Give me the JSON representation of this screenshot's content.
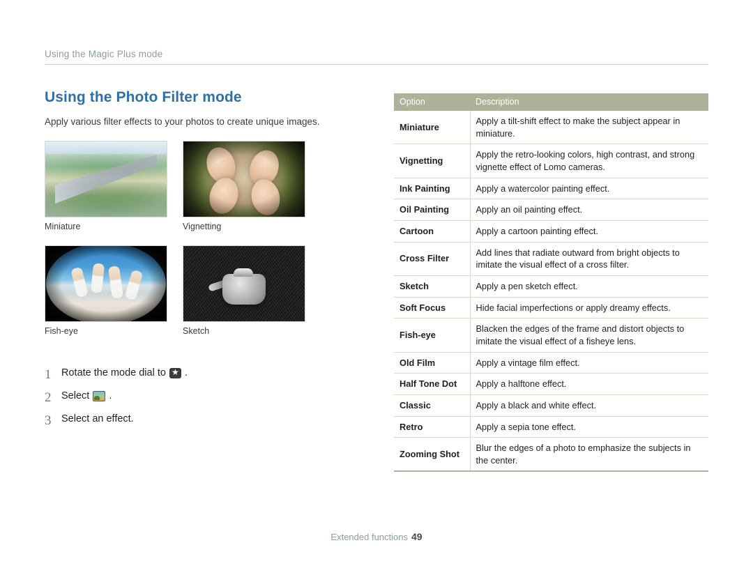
{
  "running_head": "Using the Magic Plus mode",
  "page": {
    "title": "Using the Photo Filter mode",
    "intro": "Apply various filter effects to your photos to create unique images."
  },
  "thumbnails": [
    {
      "label": "Miniature",
      "icon": "miniature-photo"
    },
    {
      "label": "Vignetting",
      "icon": "vignetting-photo"
    },
    {
      "label": "Fish-eye",
      "icon": "fisheye-photo"
    },
    {
      "label": "Sketch",
      "icon": "sketch-photo"
    }
  ],
  "steps": [
    {
      "num": "1",
      "text_before": "Rotate the mode dial to",
      "icon": "mode-dial-smart-icon",
      "text_after": "."
    },
    {
      "num": "2",
      "text_before": "Select",
      "icon": "photo-filter-mode-icon",
      "text_after": "."
    },
    {
      "num": "3",
      "text_before": "Select an effect.",
      "icon": "",
      "text_after": ""
    }
  ],
  "table": {
    "headers": [
      "Option",
      "Description"
    ],
    "rows": [
      {
        "option": "Miniature",
        "description": "Apply a tilt-shift effect to make the subject appear in miniature."
      },
      {
        "option": "Vignetting",
        "description": "Apply the retro-looking colors, high contrast, and strong vignette effect of Lomo cameras."
      },
      {
        "option": "Ink Painting",
        "description": "Apply a watercolor painting effect."
      },
      {
        "option": "Oil Painting",
        "description": "Apply an oil painting effect."
      },
      {
        "option": "Cartoon",
        "description": "Apply a cartoon painting effect."
      },
      {
        "option": "Cross Filter",
        "description": "Add lines that radiate outward from bright objects to imitate the visual effect of a cross filter."
      },
      {
        "option": "Sketch",
        "description": "Apply a pen sketch effect."
      },
      {
        "option": "Soft Focus",
        "description": "Hide facial imperfections or apply dreamy effects."
      },
      {
        "option": "Fish-eye",
        "description": "Blacken the edges of the frame and distort objects to imitate the visual effect of a fisheye lens."
      },
      {
        "option": "Old Film",
        "description": "Apply a vintage film effect."
      },
      {
        "option": "Half Tone Dot",
        "description": "Apply a halftone effect."
      },
      {
        "option": "Classic",
        "description": "Apply a black and white effect."
      },
      {
        "option": "Retro",
        "description": "Apply a sepia tone effect."
      },
      {
        "option": "Zooming Shot",
        "description": "Blur the edges of a photo to emphasize the subjects in the center."
      }
    ]
  },
  "footer": {
    "label": "Extended functions",
    "page_number": "49"
  },
  "colors": {
    "title": "#2f6fa8",
    "table_header_bg": "#b0b19a",
    "rule": "#c9ccce",
    "muted_text": "#8c9aa3"
  }
}
